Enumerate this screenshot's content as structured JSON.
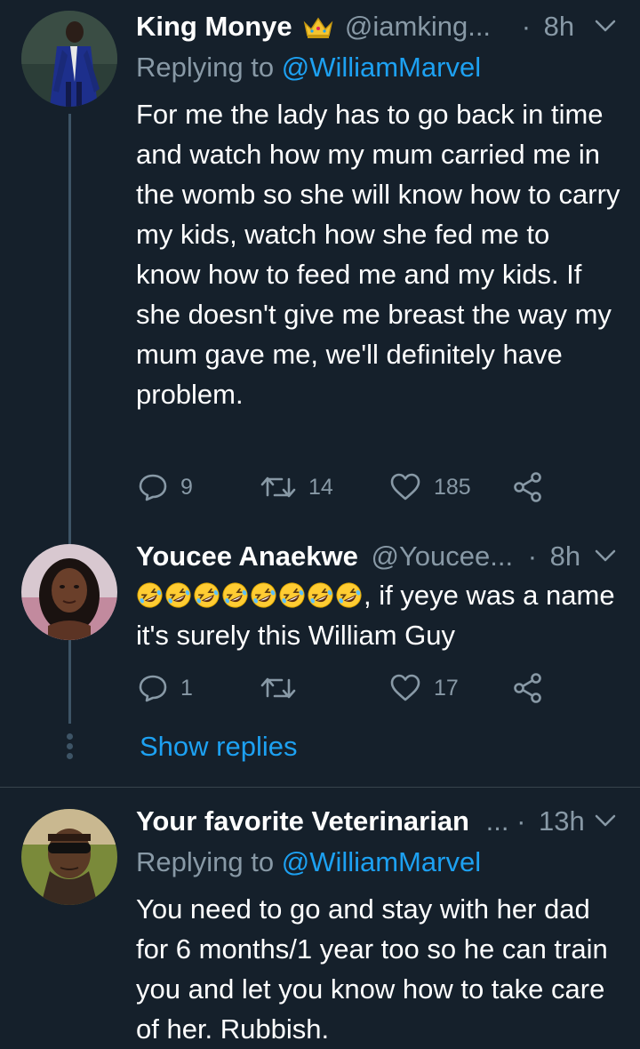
{
  "tweets": [
    {
      "name": "King Monye",
      "handle": "@iamking...",
      "dot": "·",
      "time": "8h",
      "reply_prefix": "Replying to ",
      "reply_handle": "@WilliamMarvel",
      "text": "For me the lady has to go back in time and watch how my mum carried me in the womb so she will know how to carry my kids, watch how she fed me to know how to feed me and my kids. If she doesn't give me breast the way my mum gave me, we'll definitely have problem.",
      "replies": "9",
      "retweets": "14",
      "likes": "185",
      "name_badge": "crown-emoji"
    },
    {
      "name": "Youcee Anaekwe",
      "handle": "@Youcee...",
      "dot": "·",
      "time": "8h",
      "emoji_count": 8,
      "emoji": "rolling-on-floor-laughing",
      "text": ", if yeye was a name it's surely this William Guy",
      "replies": "1",
      "retweets": "",
      "likes": "17",
      "show_replies": "Show replies"
    },
    {
      "name": "Your favorite Veterinarian",
      "handle": "...",
      "dot": "·",
      "time": "13h",
      "reply_prefix": "Replying to ",
      "reply_handle": "@WilliamMarvel",
      "text": "You need to go and stay with her dad for 6 months/1 year too so he can train you and let you know how to take care of her. Rubbish."
    }
  ],
  "colors": {
    "background": "#15202b",
    "primary_text": "#ffffff",
    "secondary_text": "#8899a6",
    "accent": "#1da1f2",
    "thread_line": "#3d5466",
    "divider": "#38444d"
  },
  "icons": [
    "reply-icon",
    "retweet-icon",
    "like-icon",
    "share-icon",
    "chevron-down-icon",
    "more-dots-icon"
  ]
}
